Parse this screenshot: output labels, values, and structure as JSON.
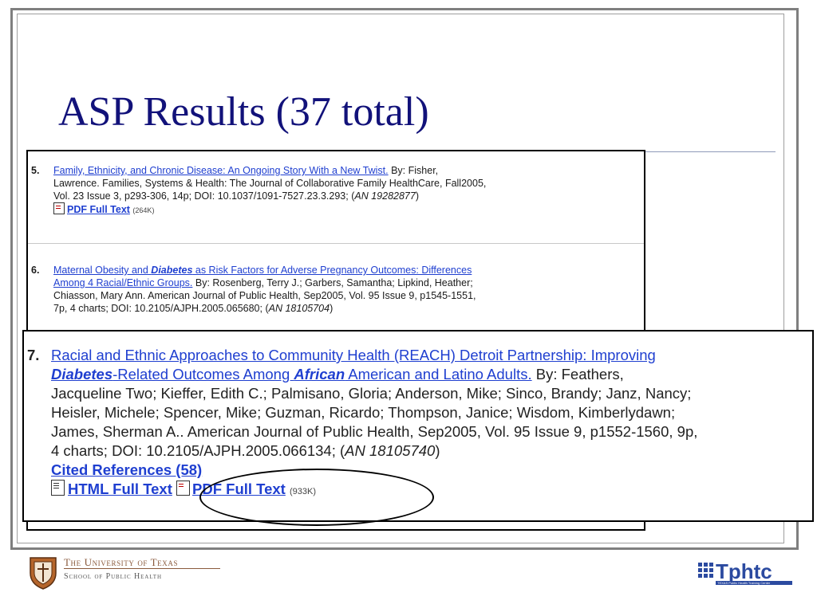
{
  "slide": {
    "title": "ASP Results (37 total)"
  },
  "records_background": [
    {
      "num": "5.",
      "title": "Family, Ethnicity, and Chronic Disease: An Ongoing Story With a New Twist.",
      "by": " By: Fisher,",
      "line2": "Lawrence. Families, Systems & Health: The Journal of Collaborative Family HealthCare, Fall2005,",
      "line3_pre": "Vol. 23 Issue 3, p293-306, 14p; DOI: 10.1037/1091-7527.23.3.293; (",
      "an": "AN 19282877",
      "line3_post": ")",
      "pdf_label": "PDF Full Text",
      "pdf_size": "(264K)"
    },
    {
      "num": "6.",
      "title_a": "Maternal Obesity and ",
      "title_em": "Diabetes",
      "title_b": " as Risk Factors for Adverse Pregnancy Outcomes: Differences",
      "title_c": "Among 4 Racial/Ethnic Groups.",
      "by": " By: Rosenberg, Terry J.; Garbers, Samantha; Lipkind, Heather;",
      "line3": "Chiasson, Mary Ann. American Journal of Public Health, Sep2005, Vol. 95 Issue 9, p1545-1551,",
      "line4_pre": "7p, 4 charts; DOI: 10.2105/AJPH.2005.065680; (",
      "an": "AN 18105704",
      "line4_post": ")"
    }
  ],
  "record_featured": {
    "num": "7.",
    "title_a": "Racial and Ethnic Approaches to Community Health (REACH) Detroit Partnership: Improving",
    "title_em1": "Diabetes",
    "title_b": "-Related Outcomes Among ",
    "title_em2": "African",
    "title_c": " American and Latino Adults.",
    "by": " By: Feathers,",
    "line3": "Jacqueline Two; Kieffer, Edith C.; Palmisano, Gloria; Anderson, Mike; Sinco, Brandy; Janz, Nancy;",
    "line4": "Heisler, Michele; Spencer, Mike; Guzman, Ricardo; Thompson, Janice; Wisdom, Kimberlydawn;",
    "line5": "James, Sherman A.. American Journal of Public Health, Sep2005, Vol. 95 Issue 9, p1552-1560, 9p,",
    "line6_pre": "4 charts; DOI: 10.2105/AJPH.2005.066134; (",
    "an": "AN 18105740",
    "line6_post": ")",
    "cited_label": "Cited References (58)",
    "html_label": "HTML Full Text",
    "pdf_label": "PDF Full Text",
    "pdf_size": "(933K)"
  },
  "footer": {
    "ut_line1": "The University of Texas",
    "ut_line2": "School of Public Health",
    "tphtc_logo_text": "Tphtc",
    "tphtc_sub": "TEXAS Public Health Training Center"
  },
  "colors": {
    "title": "#12127a",
    "link": "#1f3fd0",
    "ut_brown": "#8a5a3c",
    "tphtc_blue": "#2b4aa0"
  }
}
